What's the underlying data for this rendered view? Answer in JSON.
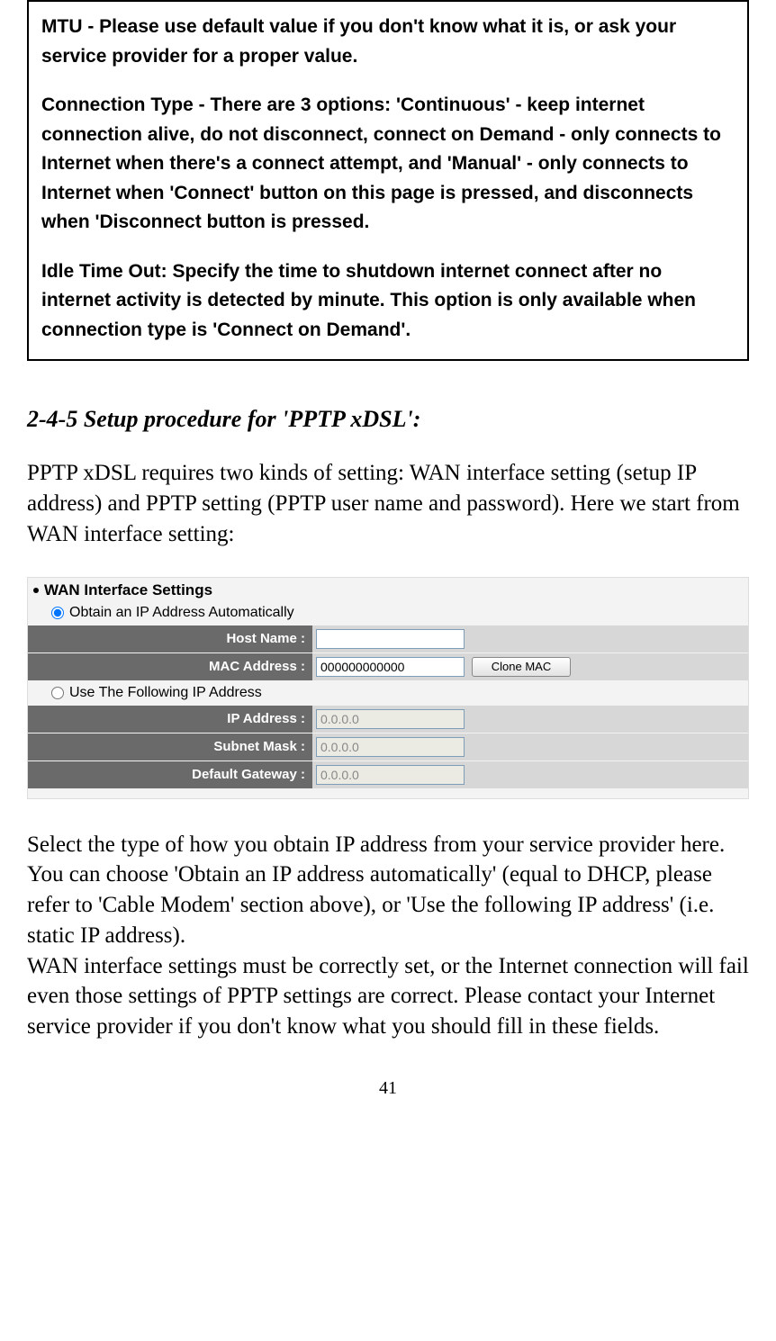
{
  "info_box": {
    "p1": "MTU - Please use default value if you don't know what it is, or ask your service provider for a proper value.",
    "p2": "Connection Type - There are 3 options: 'Continuous' - keep internet connection alive, do not disconnect, connect on Demand - only connects to Internet when there's a connect attempt, and 'Manual' - only connects to Internet when 'Connect' button on this page is pressed, and disconnects when 'Disconnect button is pressed.",
    "p3": "Idle Time Out: Specify the time to shutdown internet connect after no internet activity is detected by minute. This option is only available when connection type is 'Connect on Demand'."
  },
  "heading": "2-4-5 Setup procedure for 'PPTP xDSL':",
  "intro_para": "PPTP xDSL requires two kinds of setting: WAN interface setting (setup IP address) and PPTP setting (PPTP user name and password). Here we start from WAN interface setting:",
  "wan": {
    "title": "WAN Interface Settings",
    "radio_auto_label": "Obtain an IP Address Automatically",
    "radio_static_label": "Use The Following IP Address",
    "host_name_label": "Host Name :",
    "host_name_value": "",
    "mac_label": "MAC Address :",
    "mac_value": "000000000000",
    "clone_button_label": "Clone MAC",
    "ip_label": "IP Address :",
    "ip_value": "0.0.0.0",
    "subnet_label": "Subnet Mask :",
    "subnet_value": "0.0.0.0",
    "gateway_label": "Default Gateway :",
    "gateway_value": "0.0.0.0"
  },
  "after_para1": "Select the type of how you obtain IP address from your service provider here. You can choose 'Obtain an IP address automatically' (equal to DHCP, please refer to 'Cable Modem' section above), or 'Use the following IP address' (i.e. static IP address).",
  "after_para2": "WAN interface settings must be correctly set, or the Internet connection will fail even those settings of PPTP settings are correct. Please contact your Internet service provider if you don't know what you should fill in these fields.",
  "page_number": "41"
}
